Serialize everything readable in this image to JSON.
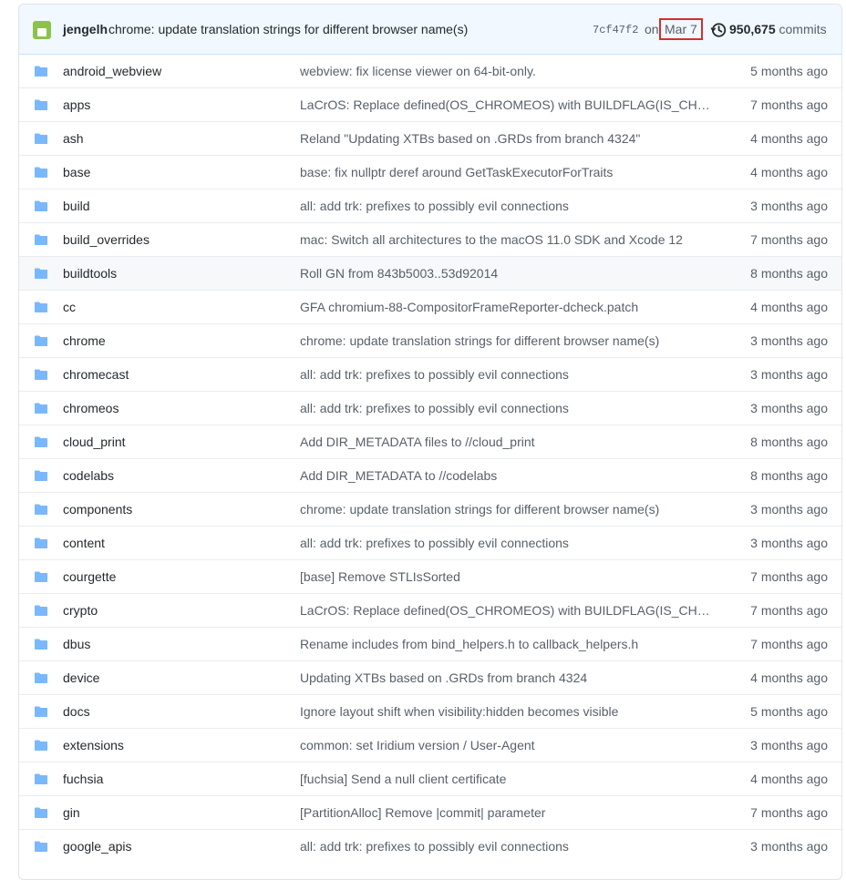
{
  "latest_commit": {
    "author": "jengelh",
    "message": "chrome: update translation strings for different browser name(s)",
    "sha": "7cf47f2",
    "on_label": "on",
    "date": "Mar 7",
    "commit_count": "950,675",
    "commits_label": "commits"
  },
  "colors": {
    "folder": "#79b8ff",
    "highlight_border": "#d32f2f",
    "avatar": "#8bc34a"
  },
  "files": [
    {
      "name": "android_webview",
      "message": "webview: fix license viewer on 64-bit-only.",
      "age": "5 months ago"
    },
    {
      "name": "apps",
      "message": "LaCrOS: Replace defined(OS_CHROMEOS) with BUILDFLAG(IS_CHROMEOS_ASH)",
      "age": "7 months ago"
    },
    {
      "name": "ash",
      "message": "Reland \"Updating XTBs based on .GRDs from branch 4324\"",
      "age": "4 months ago"
    },
    {
      "name": "base",
      "message": "base: fix nullptr deref around GetTaskExecutorForTraits",
      "age": "4 months ago"
    },
    {
      "name": "build",
      "message": "all: add trk: prefixes to possibly evil connections",
      "age": "3 months ago"
    },
    {
      "name": "build_overrides",
      "message": "mac: Switch all architectures to the macOS 11.0 SDK and Xcode 12",
      "age": "7 months ago"
    },
    {
      "name": "buildtools",
      "message": "Roll GN from 843b5003..53d92014",
      "age": "8 months ago"
    },
    {
      "name": "cc",
      "message": "GFA chromium-88-CompositorFrameReporter-dcheck.patch",
      "age": "4 months ago"
    },
    {
      "name": "chrome",
      "message": "chrome: update translation strings for different browser name(s)",
      "age": "3 months ago"
    },
    {
      "name": "chromecast",
      "message": "all: add trk: prefixes to possibly evil connections",
      "age": "3 months ago"
    },
    {
      "name": "chromeos",
      "message": "all: add trk: prefixes to possibly evil connections",
      "age": "3 months ago"
    },
    {
      "name": "cloud_print",
      "message": "Add DIR_METADATA files to //cloud_print",
      "age": "8 months ago"
    },
    {
      "name": "codelabs",
      "message": "Add DIR_METADATA to //codelabs",
      "age": "8 months ago"
    },
    {
      "name": "components",
      "message": "chrome: update translation strings for different browser name(s)",
      "age": "3 months ago"
    },
    {
      "name": "content",
      "message": "all: add trk: prefixes to possibly evil connections",
      "age": "3 months ago"
    },
    {
      "name": "courgette",
      "message": "[base] Remove STLIsSorted",
      "age": "7 months ago"
    },
    {
      "name": "crypto",
      "message": "LaCrOS: Replace defined(OS_CHROMEOS) with BUILDFLAG(IS_CHROMEOS_ASH)",
      "age": "7 months ago"
    },
    {
      "name": "dbus",
      "message": "Rename includes from bind_helpers.h to callback_helpers.h",
      "age": "7 months ago"
    },
    {
      "name": "device",
      "message": "Updating XTBs based on .GRDs from branch 4324",
      "age": "4 months ago"
    },
    {
      "name": "docs",
      "message": "Ignore layout shift when visibility:hidden becomes visible",
      "age": "5 months ago"
    },
    {
      "name": "extensions",
      "message": "common: set Iridium version / User-Agent",
      "age": "3 months ago"
    },
    {
      "name": "fuchsia",
      "message": "[fuchsia] Send a null client certificate",
      "age": "4 months ago"
    },
    {
      "name": "gin",
      "message": "[PartitionAlloc] Remove |commit| parameter",
      "age": "7 months ago"
    },
    {
      "name": "google_apis",
      "message": "all: add trk: prefixes to possibly evil connections",
      "age": "3 months ago"
    }
  ]
}
